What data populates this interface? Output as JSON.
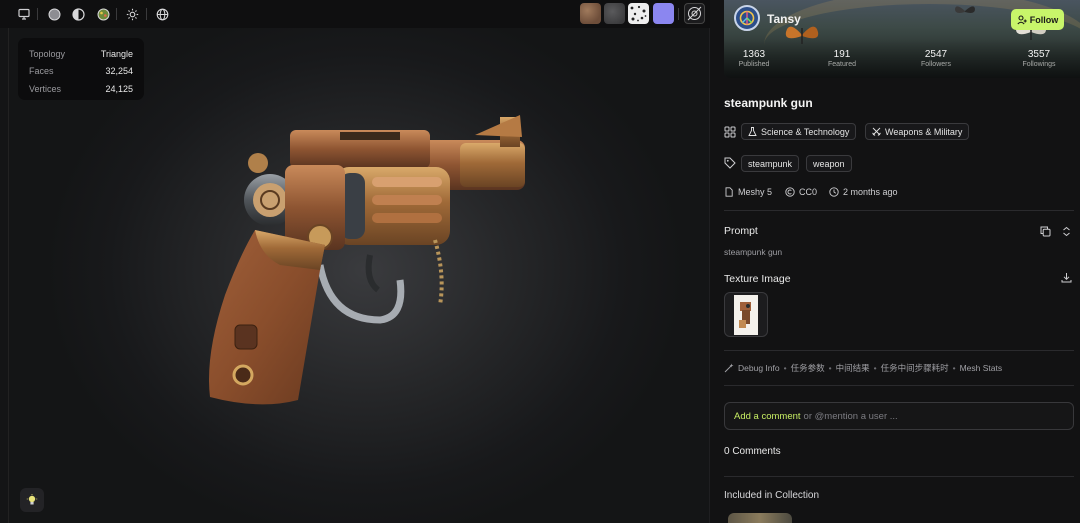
{
  "viewer": {
    "stats": [
      {
        "key": "Topology",
        "value": "Triangle"
      },
      {
        "key": "Faces",
        "value": "32,254"
      },
      {
        "key": "Vertices",
        "value": "24,125"
      }
    ],
    "toolbar_icons": [
      "monitor-icon",
      "solid-sphere-icon",
      "half-sphere-icon",
      "color-sphere-icon",
      "sun-icon",
      "globe-icon"
    ],
    "material_swatches": [
      {
        "name": "texture-swatch-rust",
        "color": "#8a6a52"
      },
      {
        "name": "texture-swatch-gray",
        "color": "#4a4a4c"
      },
      {
        "name": "texture-swatch-speckle",
        "color": "#e9e9e9"
      },
      {
        "name": "texture-swatch-lavender",
        "color": "#8b86f0"
      }
    ]
  },
  "profile": {
    "username": "Tansy",
    "follow_label": "Follow",
    "stats": [
      {
        "value": "1363",
        "label": "Published"
      },
      {
        "value": "191",
        "label": "Featured"
      },
      {
        "value": "2547",
        "label": "Followers"
      },
      {
        "value": "3557",
        "label": "Followings"
      }
    ]
  },
  "model": {
    "title": "steampunk gun",
    "categories": [
      "Science & Technology",
      "Weapons & Military"
    ],
    "tags": [
      "steampunk",
      "weapon"
    ],
    "engine": "Meshy 5",
    "license": "CC0",
    "time": "2 months ago"
  },
  "prompt": {
    "title": "Prompt",
    "text": "steampunk gun"
  },
  "texture": {
    "title": "Texture Image"
  },
  "debug": {
    "items": [
      "Debug Info",
      "任务参数",
      "中间结果",
      "任务中间步骤耗时",
      "Mesh Stats"
    ]
  },
  "comments": {
    "add_label": "Add a comment",
    "placeholder": "or @mention a user ...",
    "count_label": "0 Comments"
  },
  "collection": {
    "title": "Included in Collection"
  },
  "colors": {
    "accent": "#c8f56a",
    "panel_bg": "#121213",
    "viewer_bg": "#262729"
  }
}
